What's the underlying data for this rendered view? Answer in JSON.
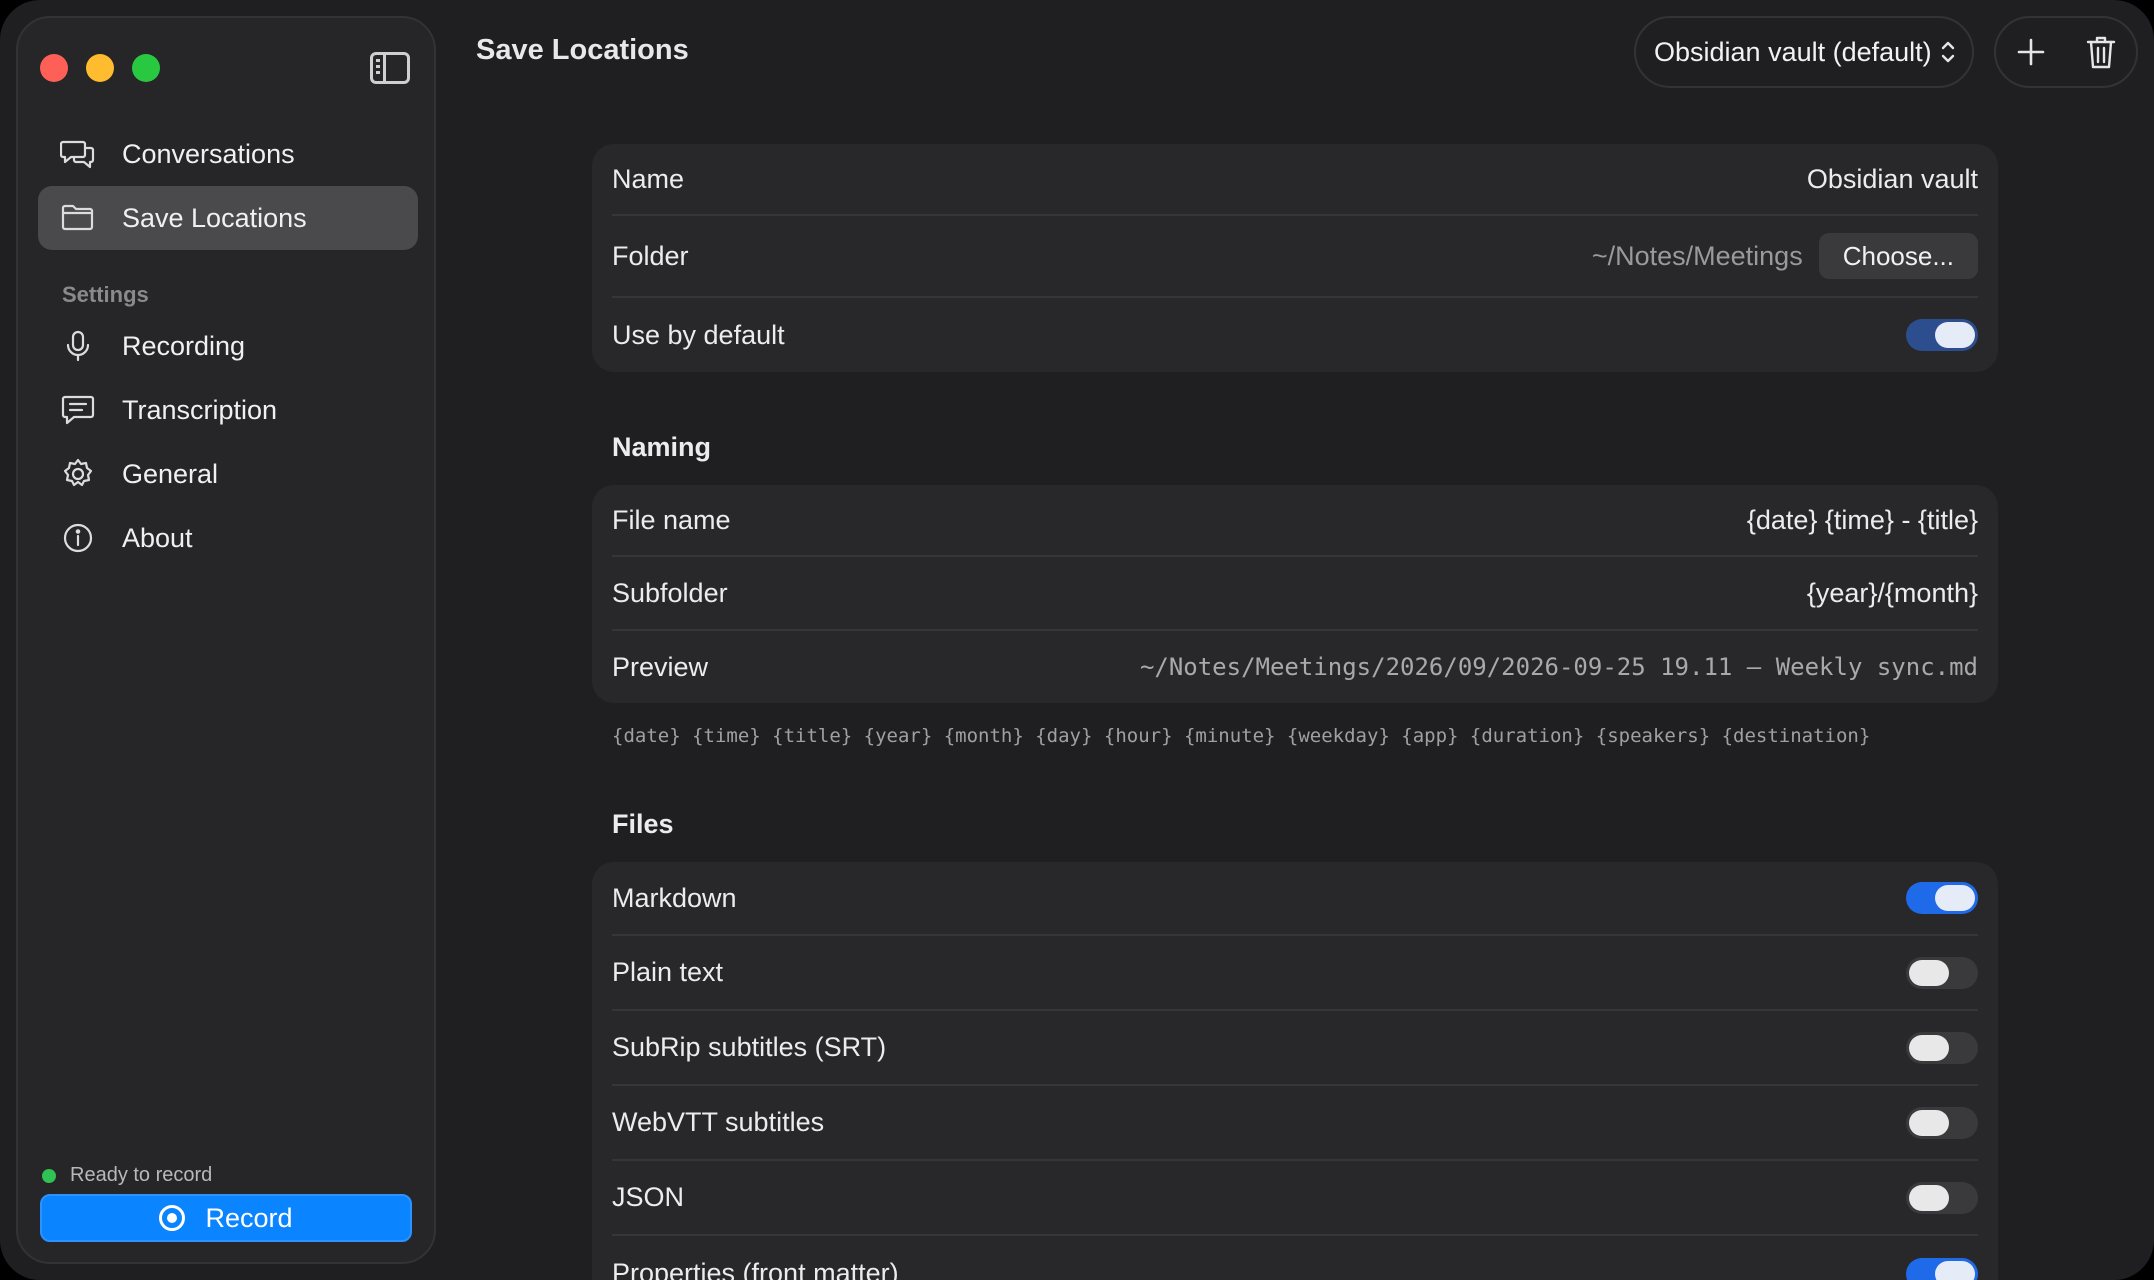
{
  "sidebar": {
    "nav_top": [
      {
        "label": "Conversations",
        "icon": "chat-bubbles-icon"
      },
      {
        "label": "Save Locations",
        "icon": "folder-icon",
        "active": true
      }
    ],
    "settings_label": "Settings",
    "nav_settings": [
      {
        "label": "Recording",
        "icon": "microphone-icon"
      },
      {
        "label": "Transcription",
        "icon": "transcript-icon"
      },
      {
        "label": "General",
        "icon": "gear-icon"
      },
      {
        "label": "About",
        "icon": "info-icon"
      }
    ],
    "status": "Ready to record",
    "record_label": "Record"
  },
  "header": {
    "title": "Save Locations",
    "vault_select": "Obsidian vault (default)"
  },
  "location": {
    "name_label": "Name",
    "name_value": "Obsidian vault",
    "folder_label": "Folder",
    "folder_value": "~/Notes/Meetings",
    "choose_label": "Choose...",
    "default_label": "Use by default",
    "default_on": true
  },
  "naming": {
    "heading": "Naming",
    "file_name_label": "File name",
    "file_name_value": "{date} {time} - {title}",
    "subfolder_label": "Subfolder",
    "subfolder_value": "{year}/{month}",
    "preview_label": "Preview",
    "preview_value": "~/Notes/Meetings/2026/09/2026-09-25 19.11 – Weekly sync.md",
    "tokens_hint": "{date} {time} {title} {year} {month} {day} {hour} {minute} {weekday} {app} {duration} {speakers} {destination}"
  },
  "files": {
    "heading": "Files",
    "items": [
      {
        "label": "Markdown",
        "on": true
      },
      {
        "label": "Plain text",
        "on": false
      },
      {
        "label": "SubRip subtitles (SRT)",
        "on": false
      },
      {
        "label": "WebVTT subtitles",
        "on": false
      },
      {
        "label": "JSON",
        "on": false
      },
      {
        "label": "Properties (front matter)",
        "on": true
      }
    ]
  },
  "colors": {
    "accent": "#0a84ff",
    "toggle_on": "#1f6ae8",
    "status_ready": "#30c253"
  }
}
